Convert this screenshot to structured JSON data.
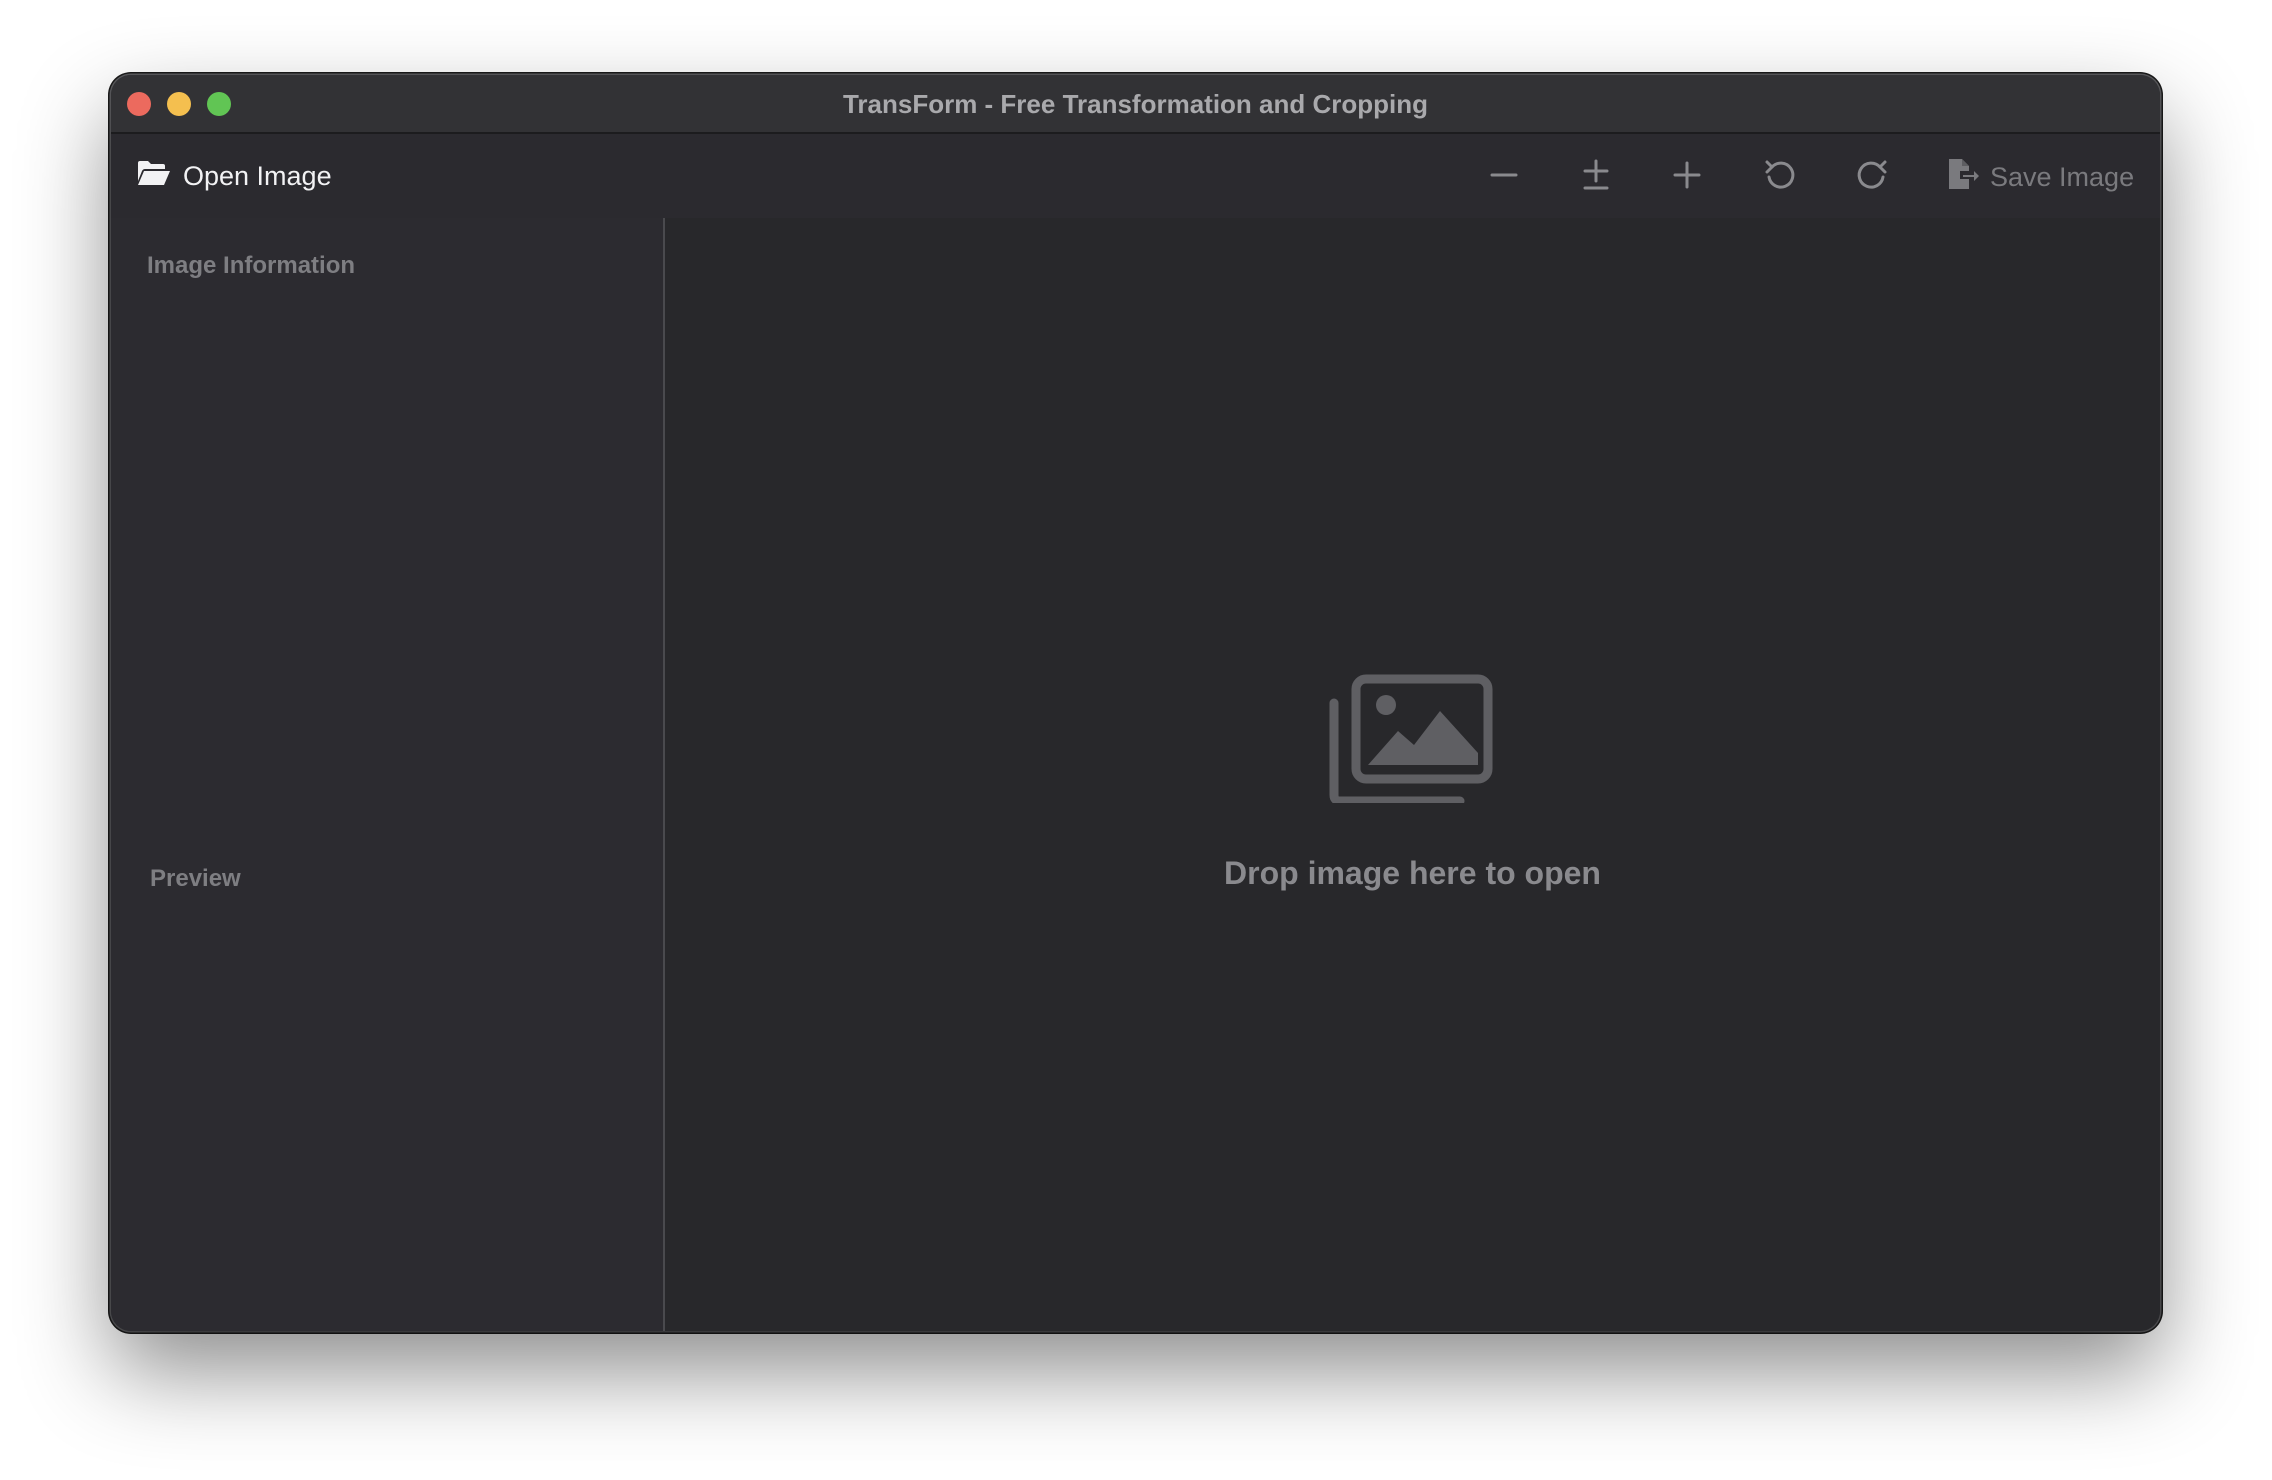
{
  "window": {
    "title": "TransForm - Free Transformation and Cropping"
  },
  "toolbar": {
    "open_label": "Open Image",
    "save_label": "Save Image",
    "tools": [
      {
        "name": "zoom-out",
        "icon": "minus-icon"
      },
      {
        "name": "zoom-fit",
        "icon": "plus-minus-icon"
      },
      {
        "name": "zoom-in",
        "icon": "plus-icon"
      },
      {
        "name": "rotate-left",
        "icon": "rotate-ccw-icon"
      },
      {
        "name": "rotate-right",
        "icon": "rotate-cw-icon"
      }
    ]
  },
  "sidebar": {
    "info_heading": "Image Information",
    "preview_heading": "Preview"
  },
  "main": {
    "drop_text": "Drop image here to open",
    "drop_icon": "photos-icon"
  },
  "colors": {
    "close": "#ec6a5e",
    "minimize": "#f4bf4f",
    "zoom": "#61c554",
    "window_bg": "#2a2a2d",
    "muted_text": "#7e7e82"
  }
}
